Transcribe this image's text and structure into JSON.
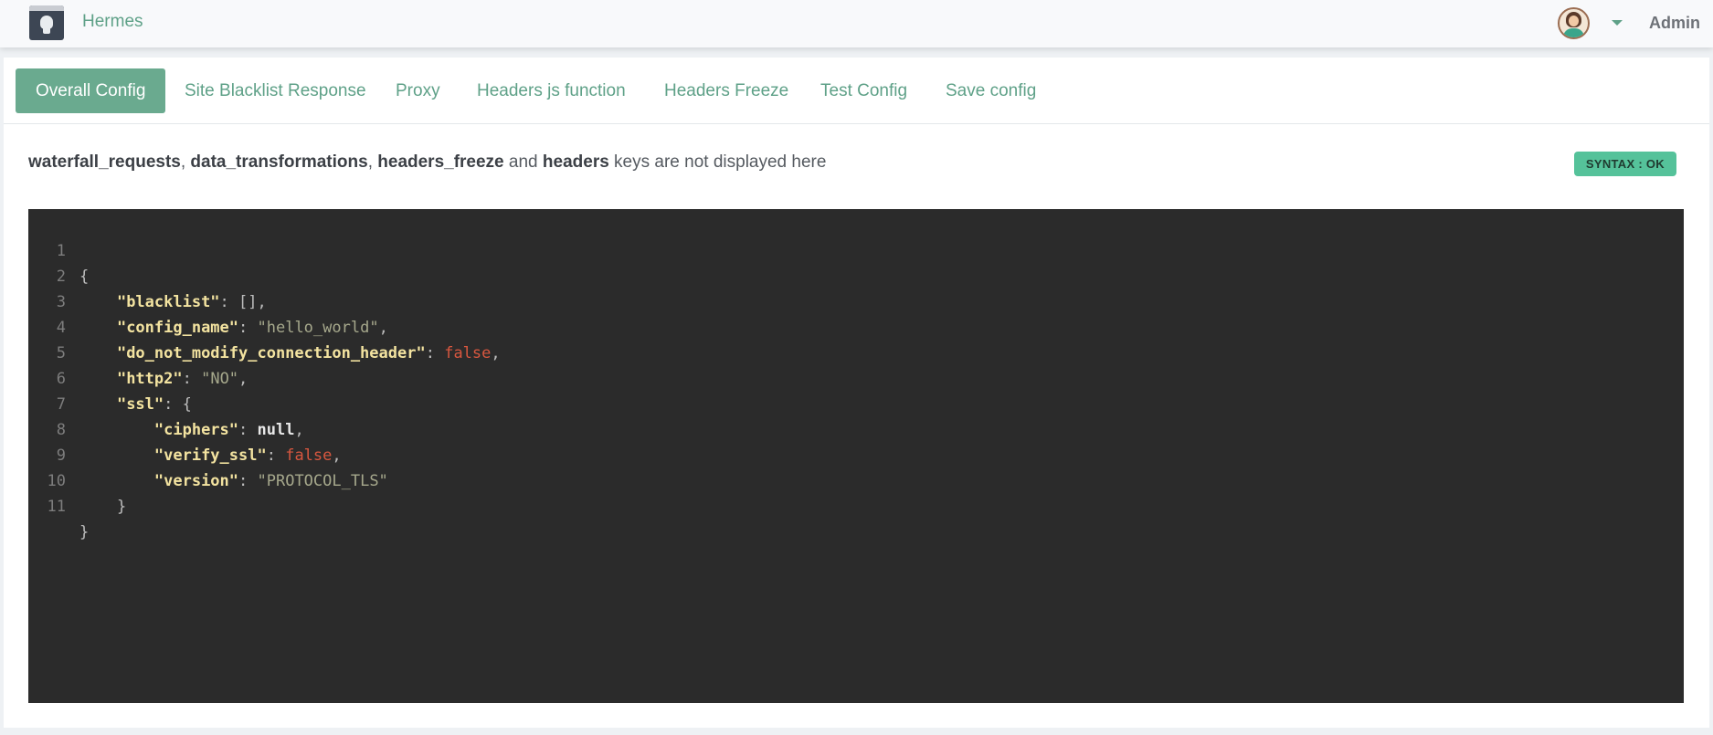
{
  "topbar": {
    "brand": "Hermes",
    "user": "Admin"
  },
  "tabs": [
    {
      "label": "Overall Config",
      "active": true
    },
    {
      "label": "Site Blacklist Response",
      "active": false
    },
    {
      "label": "Proxy",
      "active": false
    },
    {
      "label": "Headers js function",
      "active": false
    },
    {
      "label": "Headers Freeze",
      "active": false
    },
    {
      "label": "Test Config",
      "active": false
    },
    {
      "label": "Save config",
      "active": false
    }
  ],
  "notice": {
    "key1": "waterfall_requests",
    "sep1": ", ",
    "key2": "data_transformations",
    "sep2": ", ",
    "key3": "headers_freeze",
    "sep3": " and ",
    "key4": "headers",
    "rest": " keys are not displayed here"
  },
  "syntax_badge": "SYNTAX : OK",
  "editor": {
    "lines": [
      {
        "num": "1"
      },
      {
        "num": "2"
      },
      {
        "num": "3"
      },
      {
        "num": "4"
      },
      {
        "num": "5"
      },
      {
        "num": "6"
      },
      {
        "num": "7"
      },
      {
        "num": "8"
      },
      {
        "num": "9"
      },
      {
        "num": "10"
      },
      {
        "num": "11"
      }
    ],
    "tokens": {
      "open": "{",
      "blacklist_key": "\"blacklist\"",
      "blacklist_val": "[]",
      "config_name_key": "\"config_name\"",
      "config_name_val": "\"hello_world\"",
      "dnm_key": "\"do_not_modify_connection_header\"",
      "dnm_val": "false",
      "http2_key": "\"http2\"",
      "http2_val": "\"NO\"",
      "ssl_key": "\"ssl\"",
      "ssl_open": "{",
      "ciphers_key": "\"ciphers\"",
      "ciphers_val": "null",
      "verify_key": "\"verify_ssl\"",
      "verify_val": "false",
      "version_key": "\"version\"",
      "version_val": "\"PROTOCOL_TLS\"",
      "ssl_close": "}",
      "close": "}"
    }
  },
  "colors": {
    "accent": "#5fa188",
    "active_tab": "#6aaa8f",
    "badge": "#55c29a",
    "editor_bg": "#2b2b2b",
    "json_key": "#f3e3a0",
    "json_string": "#a6a88c",
    "json_bool": "#d8573f"
  },
  "icons": [
    "app-logo-icon",
    "user-avatar-icon",
    "chevron-down-icon"
  ]
}
